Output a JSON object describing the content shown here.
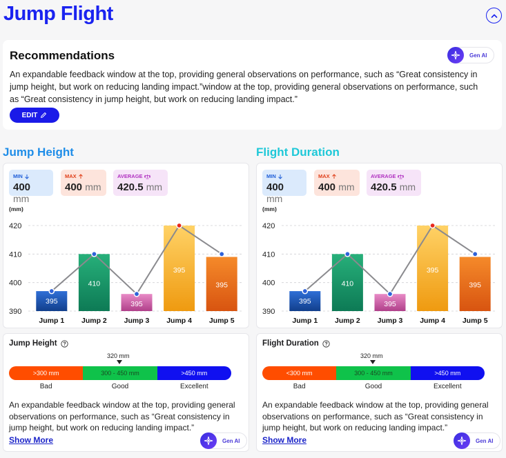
{
  "header": {
    "title": "Jump Flight"
  },
  "recommendations": {
    "title": "Recommendations",
    "text": "An expandable feedback window at the top, providing general observations on performance, such as “Great consistency in jump height, but work on reducing landing impact.”window at the top, providing general observations on performance, such as “Great consistency in jump height, but work on reducing landing impact.”",
    "edit_label": "EDIT",
    "genai_label": "Gen AI"
  },
  "colors": {
    "accent": "#1a23f0",
    "jump_height_title": "#1f8de8",
    "flight_duration_title": "#1ec8d8"
  },
  "panels": [
    {
      "title": "Jump Height",
      "stats": {
        "min": {
          "label": "MIN",
          "value": "400",
          "unit": "mm"
        },
        "max": {
          "label": "MAX",
          "value": "400",
          "unit": "mm"
        },
        "avg": {
          "label": "AVERAGE",
          "value": "420.5",
          "unit": "mm"
        }
      },
      "detail": {
        "title": "Jump Height",
        "marker": "320 mm",
        "ranges": [
          ">300 mm",
          "300 - 450 mm",
          ">450 mm"
        ],
        "range_names": [
          "Bad",
          "Good",
          "Excellent"
        ],
        "text": "An expandable feedback window at the top, providing general observations on performance, such as “Great consistency in jump height, but work on reducing landing impact.”",
        "show_more": "Show More",
        "genai_label": "Gen AI"
      }
    },
    {
      "title": "Flight Duration",
      "stats": {
        "min": {
          "label": "MIN",
          "value": "400",
          "unit": "mm"
        },
        "max": {
          "label": "MAX",
          "value": "400",
          "unit": "mm"
        },
        "avg": {
          "label": "AVERAGE",
          "value": "420.5",
          "unit": "mm"
        }
      },
      "detail": {
        "title": "Flight Duration",
        "marker": "320 mm",
        "ranges": [
          "<300 mm",
          "300 - 450 mm",
          ">450 mm"
        ],
        "range_names": [
          "Bad",
          "Good",
          "Excellent"
        ],
        "text": "An expandable feedback window at the top, providing general observations on performance, such as “Great consistency in jump height, but work on reducing landing impact.”",
        "show_more": "Show More",
        "genai_label": "Gen AI"
      }
    }
  ],
  "chart_data": [
    {
      "type": "bar",
      "ylabel": "(mm)",
      "ylim": [
        390,
        420
      ],
      "yticks": [
        390,
        400,
        410,
        420
      ],
      "categories": [
        "Jump 1",
        "Jump 2",
        "Jump 3",
        "Jump 4",
        "Jump 5"
      ],
      "values": [
        397,
        410,
        396,
        420,
        409
      ],
      "labels": [
        "395",
        "410",
        "395",
        "395",
        "395"
      ],
      "line_values": [
        397,
        410,
        396,
        420,
        410
      ],
      "bar_colors": [
        [
          "#2f6fd6",
          "#123f8c"
        ],
        [
          "#27b07a",
          "#0d7a55"
        ],
        [
          "#e88ac6",
          "#b03f8a"
        ],
        [
          "#ffd266",
          "#ef9a10"
        ],
        [
          "#f58a2a",
          "#d85410"
        ]
      ],
      "grid": true
    },
    {
      "type": "bar",
      "ylabel": "(mm)",
      "ylim": [
        390,
        420
      ],
      "yticks": [
        390,
        400,
        410,
        420
      ],
      "categories": [
        "Jump 1",
        "Jump 2",
        "Jump 3",
        "Jump 4",
        "Jump 5"
      ],
      "values": [
        397,
        410,
        396,
        420,
        409
      ],
      "labels": [
        "395",
        "410",
        "395",
        "395",
        "395"
      ],
      "line_values": [
        397,
        410,
        396,
        420,
        410
      ],
      "bar_colors": [
        [
          "#2f6fd6",
          "#123f8c"
        ],
        [
          "#27b07a",
          "#0d7a55"
        ],
        [
          "#e88ac6",
          "#b03f8a"
        ],
        [
          "#ffd266",
          "#ef9a10"
        ],
        [
          "#f58a2a",
          "#d85410"
        ]
      ],
      "grid": true
    }
  ]
}
